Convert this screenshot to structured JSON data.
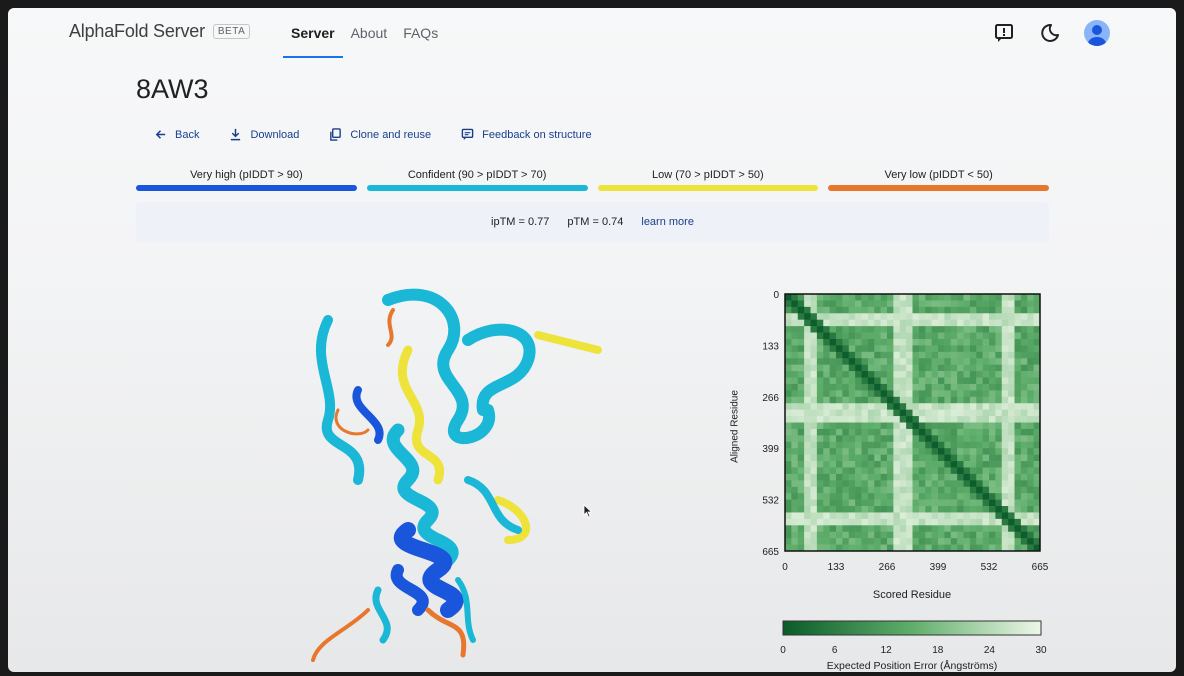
{
  "header": {
    "brand": "AlphaFold Server",
    "beta": "BETA",
    "tabs": [
      {
        "label": "Server",
        "active": true
      },
      {
        "label": "About",
        "active": false
      },
      {
        "label": "FAQs",
        "active": false
      }
    ],
    "icons": [
      "feedback-icon",
      "dark-mode-icon",
      "account-avatar-icon"
    ]
  },
  "page": {
    "title": "8AW3",
    "actions": {
      "back": "Back",
      "download": "Download",
      "clone": "Clone and reuse",
      "feedback": "Feedback on structure"
    },
    "plddt_legend": [
      {
        "label": "Very high (pIDDT > 90)",
        "color": "#1a56db"
      },
      {
        "label": "Confident (90 > pIDDT > 70)",
        "color": "#1ab7d6"
      },
      {
        "label": "Low (70 > pIDDT > 50)",
        "color": "#ede33a"
      },
      {
        "label": "Very low (pIDDT < 50)",
        "color": "#e8772e"
      }
    ],
    "metrics": {
      "iptm": "ipTM = 0.77",
      "ptm": "pTM = 0.74",
      "learn_more": "learn more"
    }
  },
  "chart_data": {
    "type": "heatmap",
    "xlabel": "Scored Residue",
    "ylabel": "Aligned Residue",
    "x_ticks": [
      "0",
      "133",
      "266",
      "399",
      "532",
      "665"
    ],
    "y_ticks": [
      "0",
      "133",
      "266",
      "399",
      "532",
      "665"
    ],
    "xlim": [
      0,
      665
    ],
    "ylim": [
      0,
      665
    ],
    "colorbar": {
      "label": "Expected Position Error (Ångströms)",
      "ticks": [
        "0",
        "6",
        "12",
        "18",
        "24",
        "30"
      ],
      "range": [
        0,
        30
      ],
      "color_low": "#0b5b2a",
      "color_high": "#eef7e8"
    }
  }
}
